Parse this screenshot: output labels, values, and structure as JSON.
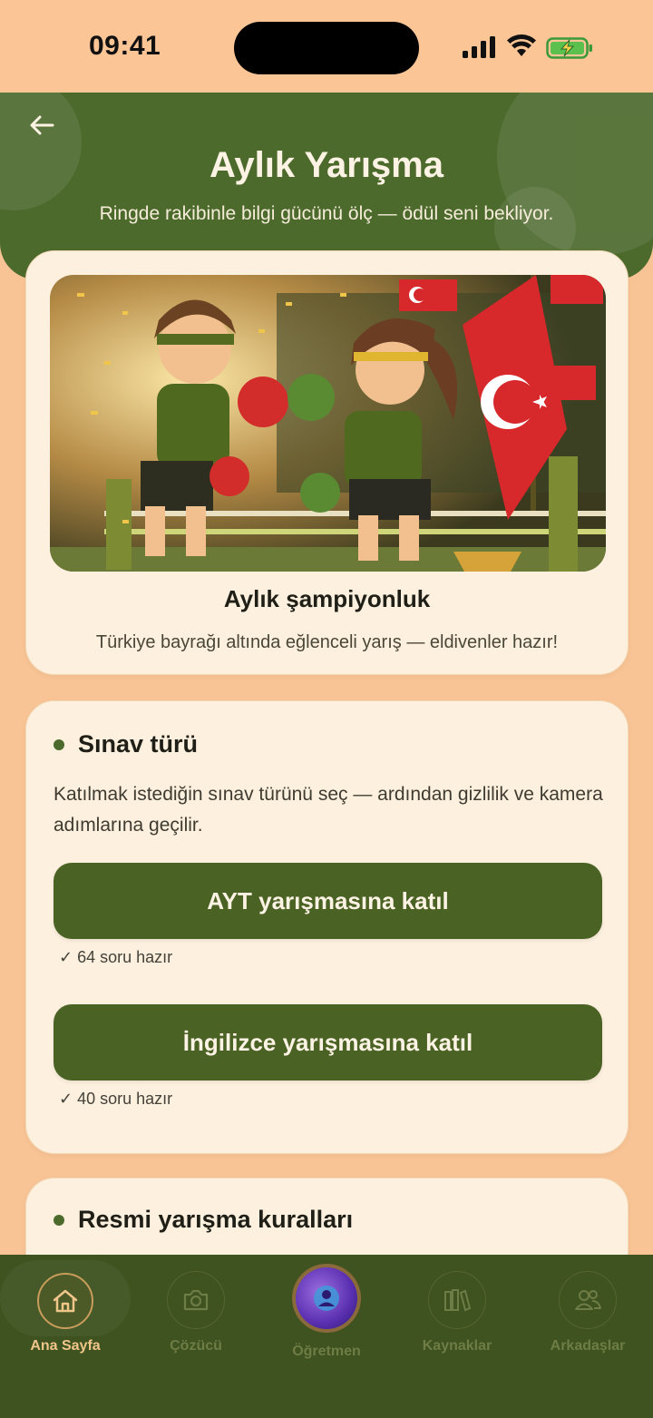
{
  "status": {
    "time": "09:41"
  },
  "header": {
    "title": "Aylık Yarışma",
    "subtitle": "Ringde rakibinle bilgi gücünü ölç — ödül seni bekliyor."
  },
  "hero": {
    "title": "Aylık şampiyonluk",
    "subtitle": "Türkiye bayrağı altında eğlenceli yarış — eldivenler hazır!"
  },
  "exam": {
    "title": "Sınav türü",
    "description": "Katılmak istediğin sınav türünü seç — ardından gizlilik ve kamera adımlarına geçilir.",
    "options": [
      {
        "label": "AYT yarışmasına katıl",
        "ready": "✓ 64 soru hazır"
      },
      {
        "label": "İngilizce yarışmasına katıl",
        "ready": "✓ 40 soru hazır"
      }
    ]
  },
  "rules": {
    "title": "Resmi yarışma kuralları"
  },
  "nav": {
    "items": [
      {
        "label": "Ana Sayfa",
        "icon": "home-icon",
        "active": true
      },
      {
        "label": "Çözücü",
        "icon": "camera-icon",
        "active": false
      },
      {
        "label": "Öğretmen",
        "icon": "teacher-orb-icon",
        "active": false
      },
      {
        "label": "Kaynaklar",
        "icon": "books-icon",
        "active": false
      },
      {
        "label": "Arkadaşlar",
        "icon": "friends-icon",
        "active": false
      }
    ]
  },
  "colors": {
    "primary": "#4d6a2d",
    "background": "#f8c496",
    "card": "#fdf0de",
    "nav": "#3f5320",
    "accent": "#f0c58a"
  }
}
